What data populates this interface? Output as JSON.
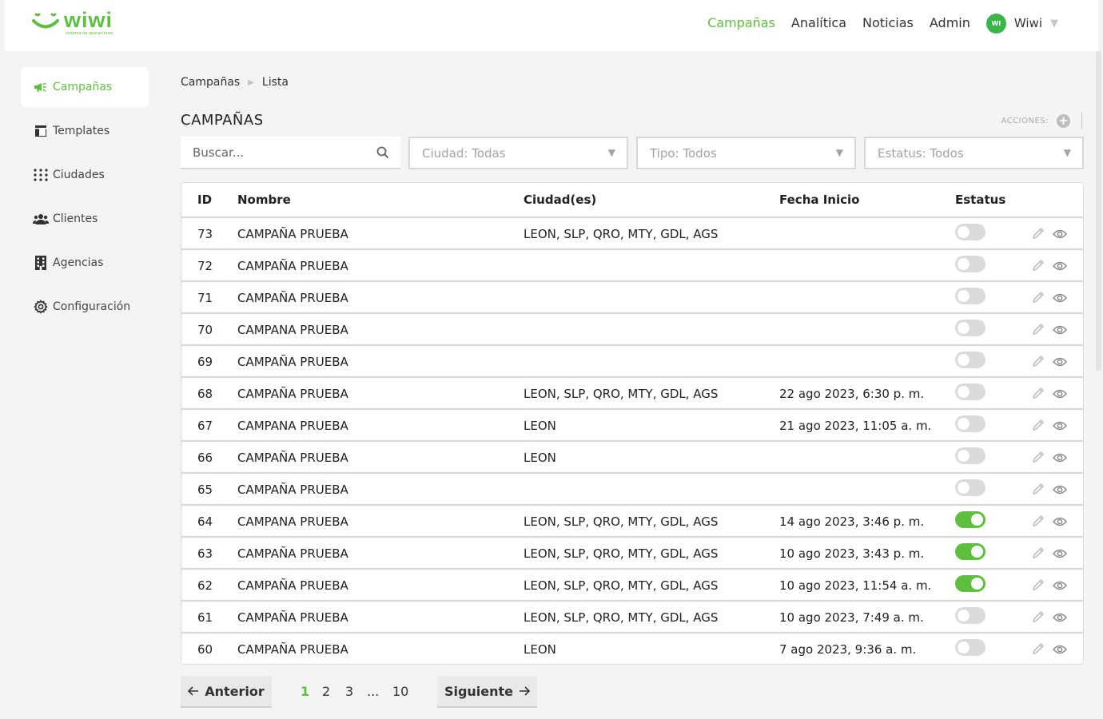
{
  "brand": {
    "name": "wiwi",
    "tagline": "sistema de operaciones"
  },
  "colors": {
    "accent": "#5cbf3e",
    "avatar": "#39b54a",
    "toggle_off": "#dadada"
  },
  "topnav": {
    "items": [
      "Campañas",
      "Analítica",
      "Noticias",
      "Admin"
    ],
    "active": "Campañas",
    "user": {
      "initials": "WI",
      "name": "Wiwi"
    }
  },
  "sidebar": {
    "items": [
      {
        "label": "Campañas",
        "icon": "megaphone-icon",
        "active": true
      },
      {
        "label": "Templates",
        "icon": "template-icon",
        "active": false
      },
      {
        "label": "Ciudades",
        "icon": "grid-dots-icon",
        "active": false
      },
      {
        "label": "Clientes",
        "icon": "users-icon",
        "active": false
      },
      {
        "label": "Agencias",
        "icon": "building-icon",
        "active": false
      },
      {
        "label": "Configuración",
        "icon": "gear-icon",
        "active": false
      }
    ]
  },
  "breadcrumb": {
    "items": [
      "Campañas",
      "Lista"
    ]
  },
  "page": {
    "title": "CAMPAÑAS",
    "actions_label": "ACCIONES:"
  },
  "filters": {
    "search_placeholder": "Buscar...",
    "ciudad": "Ciudad: Todas",
    "tipo": "Tipo: Todos",
    "estatus": "Estatus: Todos"
  },
  "table": {
    "columns": [
      "ID",
      "Nombre",
      "Ciudad(es)",
      "Fecha Inicio",
      "Estatus"
    ],
    "rows": [
      {
        "id": "73",
        "nombre": "CAMPAÑA PRUEBA",
        "ciudades": "LEON, SLP, QRO, MTY, GDL, AGS",
        "fecha": "",
        "estatus": false
      },
      {
        "id": "72",
        "nombre": "CAMPAÑA PRUEBA",
        "ciudades": "",
        "fecha": "",
        "estatus": false
      },
      {
        "id": "71",
        "nombre": "CAMPAÑA PRUEBA",
        "ciudades": "",
        "fecha": "",
        "estatus": false
      },
      {
        "id": "70",
        "nombre": "CAMPANA PRUEBA",
        "ciudades": "",
        "fecha": "",
        "estatus": false
      },
      {
        "id": "69",
        "nombre": "CAMPAÑA PRUEBA",
        "ciudades": "",
        "fecha": "",
        "estatus": false
      },
      {
        "id": "68",
        "nombre": "CAMPAÑA PRUEBA",
        "ciudades": "LEON, SLP, QRO, MTY, GDL, AGS",
        "fecha": "22 ago 2023, 6:30 p. m.",
        "estatus": false
      },
      {
        "id": "67",
        "nombre": "CAMPANA PRUEBA",
        "ciudades": "LEON",
        "fecha": "21 ago 2023, 11:05 a. m.",
        "estatus": false
      },
      {
        "id": "66",
        "nombre": "CAMPAÑA PRUEBA",
        "ciudades": "LEON",
        "fecha": "",
        "estatus": false
      },
      {
        "id": "65",
        "nombre": "CAMPAÑA PRUEBA",
        "ciudades": "",
        "fecha": "",
        "estatus": false
      },
      {
        "id": "64",
        "nombre": "CAMPANA PRUEBA",
        "ciudades": "LEON, SLP, QRO, MTY, GDL, AGS",
        "fecha": "14 ago 2023, 3:46 p. m.",
        "estatus": true
      },
      {
        "id": "63",
        "nombre": "CAMPAÑA PRUEBA",
        "ciudades": "LEON, SLP, QRO, MTY, GDL, AGS",
        "fecha": "10 ago 2023, 3:43 p. m.",
        "estatus": true
      },
      {
        "id": "62",
        "nombre": "CAMPAÑA PRUEBA",
        "ciudades": "LEON, SLP, QRO, MTY, GDL, AGS",
        "fecha": "10 ago 2023, 11:54 a. m.",
        "estatus": true
      },
      {
        "id": "61",
        "nombre": "CAMPAÑA PRUEBA",
        "ciudades": "LEON, SLP, QRO, MTY, GDL, AGS",
        "fecha": "10 ago 2023, 7:49 a. m.",
        "estatus": false
      },
      {
        "id": "60",
        "nombre": "CAMPAÑA PRUEBA",
        "ciudades": "LEON",
        "fecha": "7 ago 2023, 9:36 a. m.",
        "estatus": false
      }
    ]
  },
  "pagination": {
    "prev_label": "Anterior",
    "next_label": "Siguiente",
    "pages": [
      "1",
      "2",
      "3",
      "...",
      "10"
    ],
    "current": "1"
  }
}
